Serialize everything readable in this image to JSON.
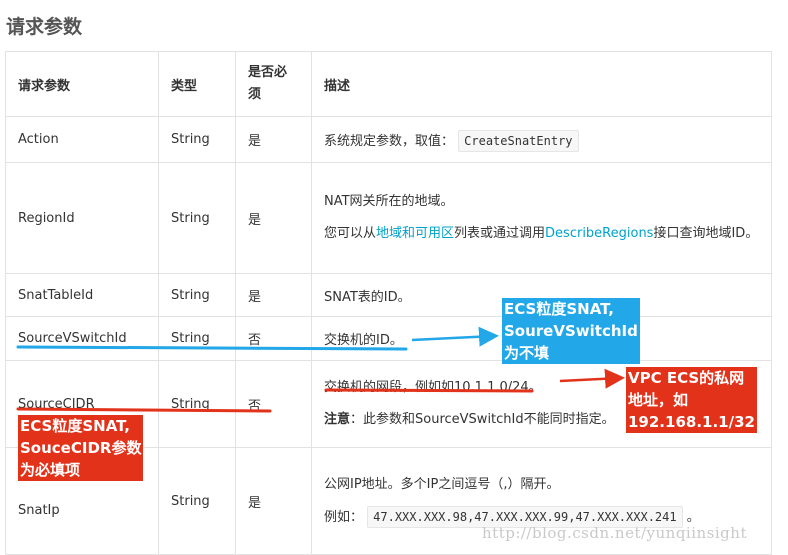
{
  "page": {
    "title": "请求参数"
  },
  "table": {
    "headers": [
      "请求参数",
      "类型",
      "是否必须",
      "描述"
    ],
    "rows": [
      {
        "name": "Action",
        "type": "String",
        "required": "是",
        "desc_text": "系统规定参数，取值：",
        "desc_code": "CreateSnatEntry"
      },
      {
        "name": "RegionId",
        "type": "String",
        "required": "是",
        "desc_line1": "NAT网关所在的地域。",
        "desc_prefix": "您可以从",
        "desc_link1": "地域和可用区",
        "desc_middle": "列表或通过调用",
        "desc_link2": "DescribeRegions",
        "desc_suffix": "接口查询地域ID。"
      },
      {
        "name": "SnatTableId",
        "type": "String",
        "required": "是",
        "desc_text": "SNAT表的ID。"
      },
      {
        "name": "SourceVSwitchId",
        "type": "String",
        "required": "否",
        "desc_text": "交换机的ID。"
      },
      {
        "name": "SourceCIDR",
        "type": "String",
        "required": "否",
        "desc_line1": "交换机的网段，例如如10.1.1.0/24。",
        "note_label": "注意",
        "note_text": "：此参数和SourceVSwitchId不能同时指定。"
      },
      {
        "name": "SnatIp",
        "type": "String",
        "required": "是",
        "desc_line1": "公网IP地址。多个IP之间逗号（,）隔开。",
        "example_label": "例如：",
        "example_code": "47.XXX.XXX.98,47.XXX.XXX.99,47.XXX.XXX.241",
        "example_suffix": "。"
      }
    ]
  },
  "annotations": {
    "blue_note": [
      "ECS粒度SNAT,",
      "SoureVSwitchId",
      "为不填"
    ],
    "red_note_right": [
      "VPC ECS的私网",
      "地址，如",
      "192.168.1.1/32"
    ],
    "red_note_left": [
      "ECS粒度SNAT,",
      "SouceCIDR参数",
      "为必填项"
    ],
    "colors": {
      "blue": "#22a7e8",
      "red": "#e3321a"
    }
  },
  "watermark": "http://blog.csdn.net/yunqiinsight"
}
